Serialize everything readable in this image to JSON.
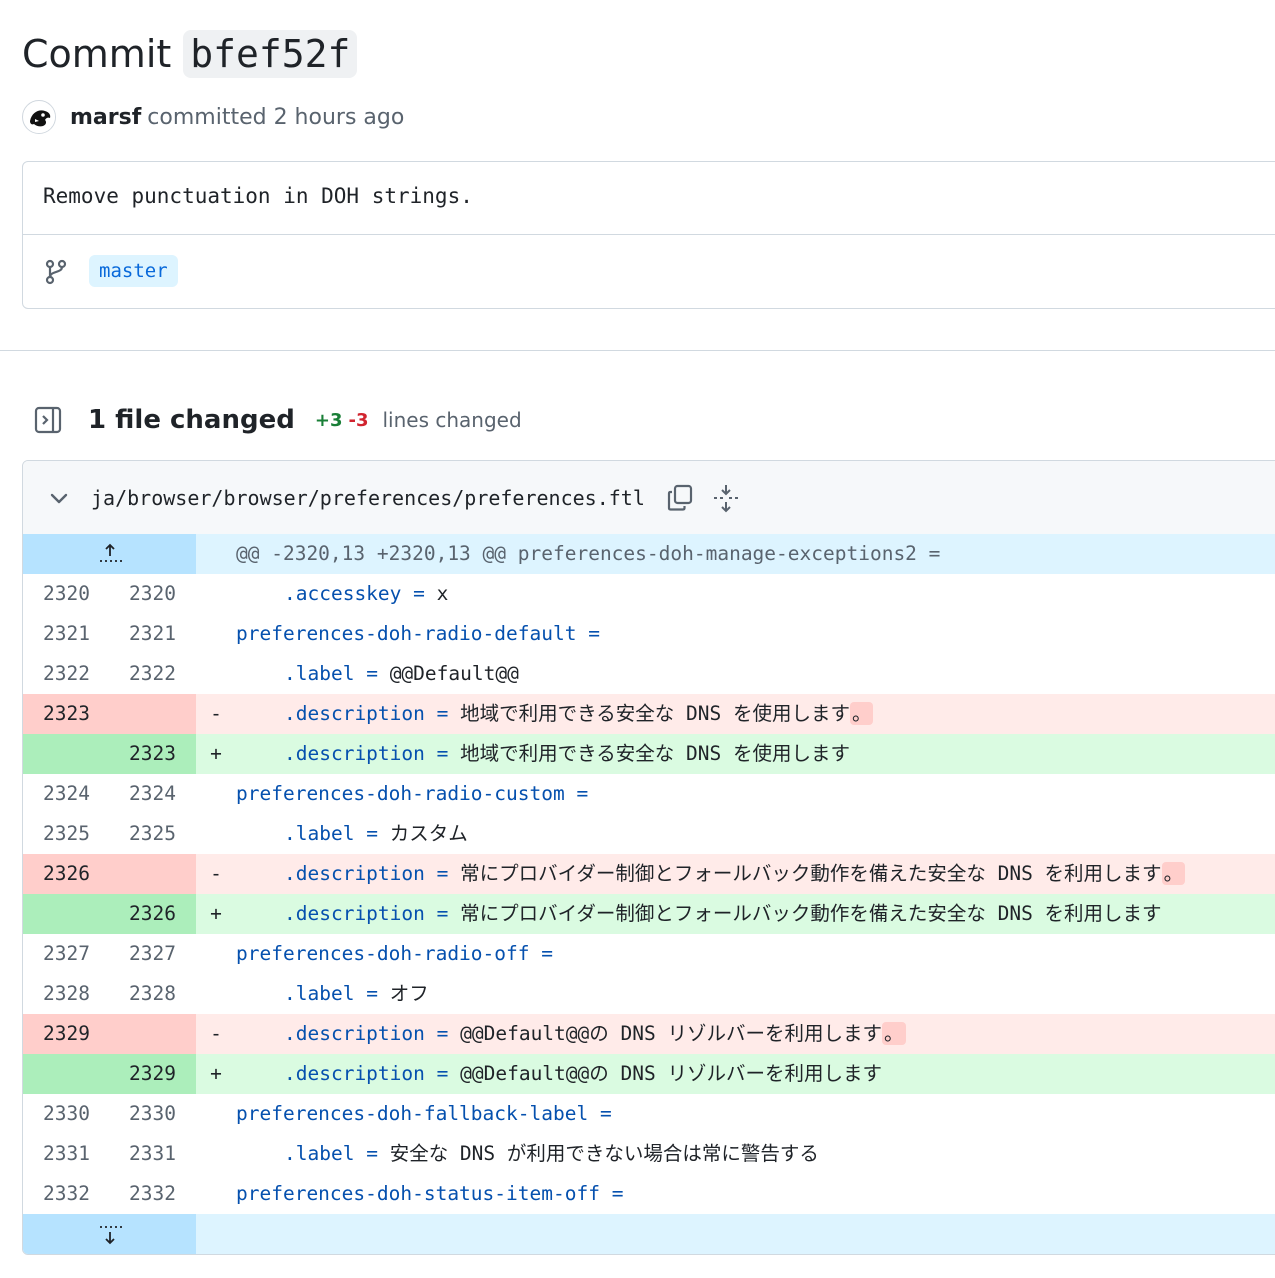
{
  "commit": {
    "title_word": "Commit",
    "sha": "bfef52f",
    "author": "marsf",
    "author_action": "committed 2 hours ago",
    "message": "Remove punctuation in DOH strings.",
    "branch": "master"
  },
  "files": {
    "title": "1 file changed",
    "additions": "+3",
    "deletions": "-3",
    "lines_label": "lines changed"
  },
  "file": {
    "path": "ja/browser/browser/preferences/preferences.ftl",
    "hunk": "@@ -2320,13 +2320,13 @@ preferences-doh-manage-exceptions2 ="
  },
  "rows": [
    {
      "type": "ctx",
      "old": "2320",
      "new": "2320",
      "indent": true,
      "key": ".accesskey",
      "op": "=",
      "val": " x"
    },
    {
      "type": "ctx",
      "old": "2321",
      "new": "2321",
      "indent": false,
      "key": "preferences-doh-radio-default",
      "op": "=",
      "val": ""
    },
    {
      "type": "ctx",
      "old": "2322",
      "new": "2322",
      "indent": true,
      "key": ".label",
      "op": "=",
      "val": " @@Default@@"
    },
    {
      "type": "del",
      "old": "2323",
      "new": "",
      "sign": "-",
      "indent": true,
      "key": ".description",
      "op": "=",
      "val": " 地域で利用できる安全な DNS を使用します",
      "hl": "。"
    },
    {
      "type": "add",
      "old": "",
      "new": "2323",
      "sign": "+",
      "indent": true,
      "key": ".description",
      "op": "=",
      "val": " 地域で利用できる安全な DNS を使用します"
    },
    {
      "type": "ctx",
      "old": "2324",
      "new": "2324",
      "indent": false,
      "key": "preferences-doh-radio-custom",
      "op": "=",
      "val": ""
    },
    {
      "type": "ctx",
      "old": "2325",
      "new": "2325",
      "indent": true,
      "key": ".label",
      "op": "=",
      "val": " カスタム"
    },
    {
      "type": "del",
      "old": "2326",
      "new": "",
      "sign": "-",
      "indent": true,
      "key": ".description",
      "op": "=",
      "val": " 常にプロバイダー制御とフォールバック動作を備えた安全な DNS を利用します",
      "hl": "。"
    },
    {
      "type": "add",
      "old": "",
      "new": "2326",
      "sign": "+",
      "indent": true,
      "key": ".description",
      "op": "=",
      "val": " 常にプロバイダー制御とフォールバック動作を備えた安全な DNS を利用します"
    },
    {
      "type": "ctx",
      "old": "2327",
      "new": "2327",
      "indent": false,
      "key": "preferences-doh-radio-off",
      "op": "=",
      "val": ""
    },
    {
      "type": "ctx",
      "old": "2328",
      "new": "2328",
      "indent": true,
      "key": ".label",
      "op": "=",
      "val": " オフ"
    },
    {
      "type": "del",
      "old": "2329",
      "new": "",
      "sign": "-",
      "indent": true,
      "key": ".description",
      "op": "=",
      "val": " @@Default@@の DNS リゾルバーを利用します",
      "hl": "。"
    },
    {
      "type": "add",
      "old": "",
      "new": "2329",
      "sign": "+",
      "indent": true,
      "key": ".description",
      "op": "=",
      "val": " @@Default@@の DNS リゾルバーを利用します"
    },
    {
      "type": "ctx",
      "old": "2330",
      "new": "2330",
      "indent": false,
      "key": "preferences-doh-fallback-label",
      "op": "=",
      "val": ""
    },
    {
      "type": "ctx",
      "old": "2331",
      "new": "2331",
      "indent": true,
      "key": ".label",
      "op": "=",
      "val": " 安全な DNS が利用できない場合は常に警告する"
    },
    {
      "type": "ctx",
      "old": "2332",
      "new": "2332",
      "indent": false,
      "key": "preferences-doh-status-item-off",
      "op": "=",
      "val": ""
    }
  ],
  "icons": {
    "avatar": "avatar-icon",
    "branch": "git-branch-icon",
    "panel": "sidebar-expand-icon",
    "chevron": "chevron-down-icon",
    "copy": "copy-icon",
    "expand": "unfold-icon",
    "expand_up": "expand-up-icon",
    "expand_down": "expand-down-icon"
  }
}
